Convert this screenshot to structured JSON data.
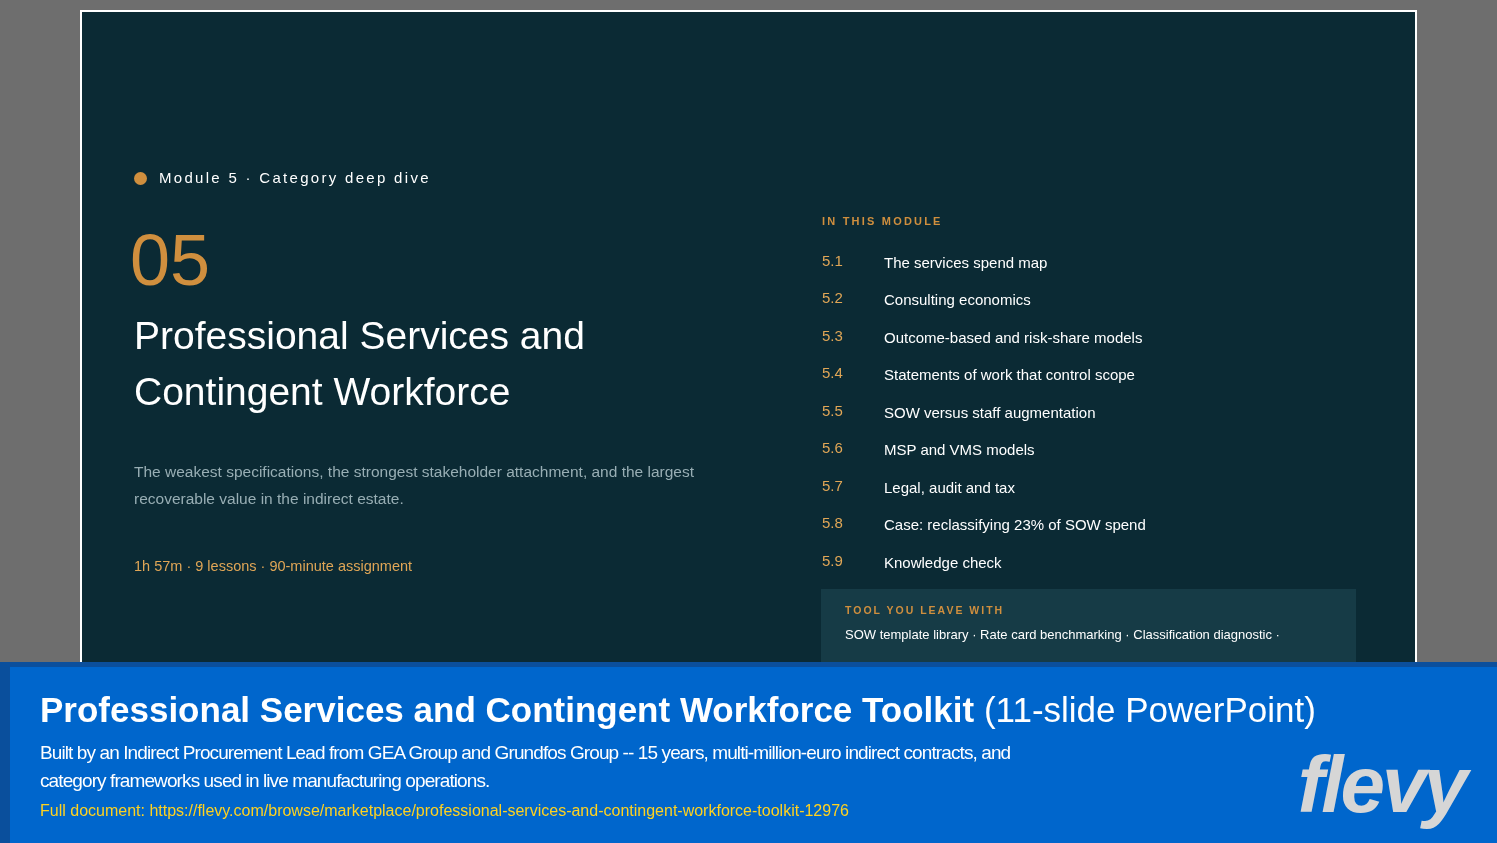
{
  "slide": {
    "eyebrow": "Module 5 · Category deep dive",
    "number": "05",
    "title": "Professional Services and Contingent Workforce",
    "description": "The weakest specifications, the strongest stakeholder attachment, and the largest recoverable value in the indirect estate.",
    "meta": "1h 57m · 9 lessons · 90-minute assignment",
    "module_heading": "IN THIS MODULE",
    "lessons": [
      {
        "number": "5.1",
        "title": "The services spend map"
      },
      {
        "number": "5.2",
        "title": "Consulting economics"
      },
      {
        "number": "5.3",
        "title": "Outcome-based and risk-share models"
      },
      {
        "number": "5.4",
        "title": "Statements of work that control scope"
      },
      {
        "number": "5.5",
        "title": "SOW versus staff augmentation"
      },
      {
        "number": "5.6",
        "title": "MSP and VMS models"
      },
      {
        "number": "5.7",
        "title": "Legal, audit and tax"
      },
      {
        "number": "5.8",
        "title": "Case: reclassifying 23% of SOW spend"
      },
      {
        "number": "5.9",
        "title": "Knowledge check"
      }
    ],
    "tool": {
      "heading": "TOOL YOU LEAVE WITH",
      "text": "SOW template library · Rate card benchmarking · Classification diagnostic ·"
    }
  },
  "banner": {
    "title": "**Professional Services and Contingent Workforce Toolkit** (11-slide PowerPoint)",
    "description": "Built by an Indirect Procurement Lead from GEA Group and Grundfos Group -- 15 years, multi-million-euro indirect contracts, and category frameworks used in live manufacturing operations.",
    "link": "Full document: https://flevy.com/browse/marketplace/professional-services-and-contingent-workforce-toolkit-12976",
    "logo": "flevy"
  }
}
